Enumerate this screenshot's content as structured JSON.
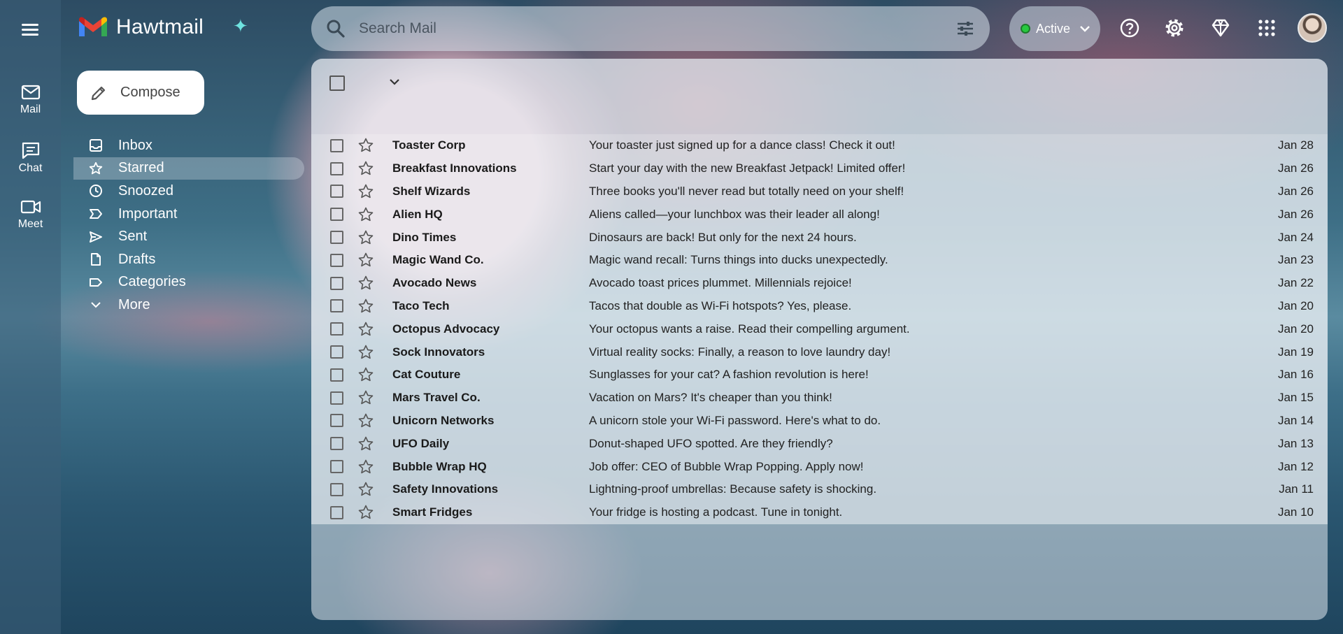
{
  "app": {
    "name": "Hawtmail"
  },
  "rail": {
    "items": [
      {
        "label": "Mail",
        "icon": "mail-icon"
      },
      {
        "label": "Chat",
        "icon": "chat-icon"
      },
      {
        "label": "Meet",
        "icon": "video-icon"
      }
    ]
  },
  "search": {
    "placeholder": "Search Mail"
  },
  "status": {
    "label": "Active",
    "color": "#27c93f"
  },
  "compose": {
    "label": "Compose"
  },
  "nav": {
    "items": [
      {
        "label": "Inbox",
        "icon": "inbox-icon"
      },
      {
        "label": "Starred",
        "icon": "star-icon",
        "active": true
      },
      {
        "label": "Snoozed",
        "icon": "clock-icon"
      },
      {
        "label": "Important",
        "icon": "important-icon"
      },
      {
        "label": "Sent",
        "icon": "send-icon"
      },
      {
        "label": "Drafts",
        "icon": "draft-icon"
      },
      {
        "label": "Categories",
        "icon": "label-icon"
      },
      {
        "label": "More",
        "icon": "chevron-down-icon"
      }
    ]
  },
  "emails": [
    {
      "sender": "Toaster Corp",
      "subject": "Your toaster just signed up for a dance class! Check it out!",
      "date": "Jan 28"
    },
    {
      "sender": "Breakfast Innovations",
      "subject": "Start your day with the new Breakfast Jetpack! Limited offer!",
      "date": "Jan 26"
    },
    {
      "sender": "Shelf Wizards",
      "subject": "Three books you'll never read but totally need on your shelf!",
      "date": "Jan 26"
    },
    {
      "sender": "Alien HQ",
      "subject": "Aliens called—your lunchbox was their leader all along!",
      "date": "Jan 26"
    },
    {
      "sender": "Dino Times",
      "subject": "Dinosaurs are back! But only for the next 24 hours.",
      "date": "Jan 24"
    },
    {
      "sender": "Magic Wand Co.",
      "subject": "Magic wand recall: Turns things into ducks unexpectedly.",
      "date": "Jan 23"
    },
    {
      "sender": "Avocado News",
      "subject": "Avocado toast prices plummet. Millennials rejoice!",
      "date": "Jan 22"
    },
    {
      "sender": "Taco Tech",
      "subject": "Tacos that double as Wi-Fi hotspots? Yes, please.",
      "date": "Jan 20"
    },
    {
      "sender": "Octopus Advocacy",
      "subject": "Your octopus wants a raise. Read their compelling argument.",
      "date": "Jan 20"
    },
    {
      "sender": "Sock Innovators",
      "subject": "Virtual reality socks: Finally, a reason to love laundry day!",
      "date": "Jan 19"
    },
    {
      "sender": "Cat Couture",
      "subject": "Sunglasses for your cat? A fashion revolution is here!",
      "date": "Jan 16"
    },
    {
      "sender": "Mars Travel Co.",
      "subject": "Vacation on Mars? It's cheaper than you think!",
      "date": "Jan 15"
    },
    {
      "sender": "Unicorn Networks",
      "subject": "A unicorn stole your Wi-Fi password. Here's what to do.",
      "date": "Jan 14"
    },
    {
      "sender": "UFO Daily",
      "subject": "Donut-shaped UFO spotted. Are they friendly?",
      "date": "Jan 13"
    },
    {
      "sender": "Bubble Wrap HQ",
      "subject": "Job offer: CEO of Bubble Wrap Popping. Apply now!",
      "date": "Jan 12"
    },
    {
      "sender": "Safety Innovations",
      "subject": "Lightning-proof umbrellas: Because safety is shocking.",
      "date": "Jan 11"
    },
    {
      "sender": "Smart Fridges",
      "subject": "Your fridge is hosting a podcast. Tune in tonight.",
      "date": "Jan 10"
    }
  ]
}
